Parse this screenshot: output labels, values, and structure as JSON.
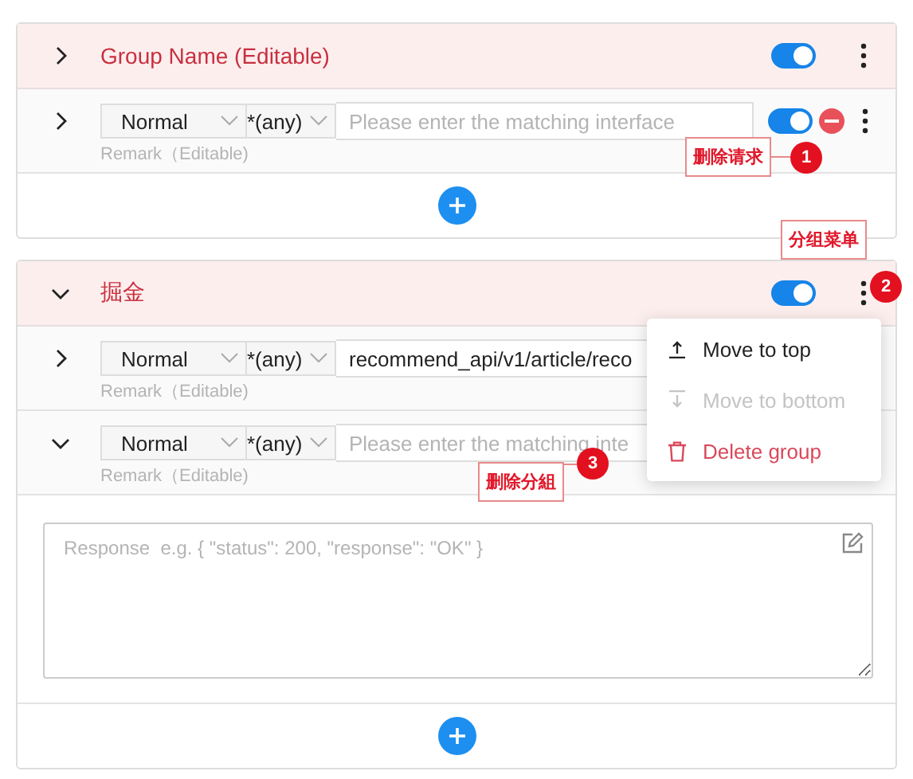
{
  "groups": [
    {
      "name": "Group Name (Editable)",
      "expanded": false,
      "on": true,
      "rows": [
        {
          "expanded": false,
          "method": "Normal",
          "status": "*(any)",
          "value": "",
          "placeholder": "Please enter the matching interface",
          "remark": "Remark（Editable)",
          "on": true,
          "removable": true
        }
      ]
    },
    {
      "name": "掘金",
      "expanded": true,
      "on": true,
      "rows": [
        {
          "expanded": false,
          "method": "Normal",
          "status": "*(any)",
          "value": "recommend_api/v1/article/reco",
          "placeholder": "",
          "remark": "Remark（Editable)",
          "removable": false
        },
        {
          "expanded": true,
          "method": "Normal",
          "status": "*(any)",
          "value": "",
          "placeholder": "Please enter the matching inte",
          "remark": "Remark（Editable)",
          "removable": false,
          "response_placeholder": "Response  e.g. { \"status\": 200, \"response\": \"OK\" }"
        }
      ]
    }
  ],
  "menu": {
    "items": [
      {
        "kind": "top",
        "label": "Move to top",
        "disabled": false
      },
      {
        "kind": "bottom",
        "label": "Move to bottom",
        "disabled": true
      },
      {
        "kind": "delete",
        "label": "Delete group",
        "disabled": false
      }
    ]
  },
  "annotations": [
    {
      "label": "删除请求",
      "number": "1"
    },
    {
      "label": "分组菜单",
      "number": "2"
    },
    {
      "label": "删除分組",
      "number": "3"
    }
  ]
}
